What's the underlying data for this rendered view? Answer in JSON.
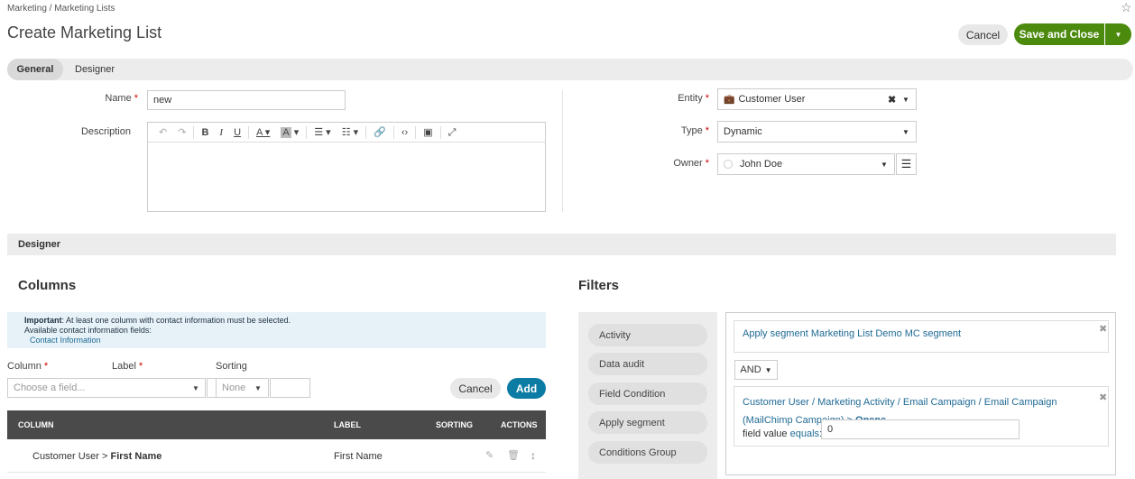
{
  "breadcrumb": "Marketing / Marketing Lists",
  "page_title": "Create Marketing List",
  "actions": {
    "cancel": "Cancel",
    "save_and_close": "Save and Close"
  },
  "tabs": [
    {
      "label": "General"
    },
    {
      "label": "Designer"
    }
  ],
  "general": {
    "name_label": "Name",
    "name_value": "new",
    "description_label": "Description",
    "entity_label": "Entity",
    "entity_value": "Customer User",
    "type_label": "Type",
    "type_value": "Dynamic",
    "owner_label": "Owner",
    "owner_value": "John Doe"
  },
  "designer_section": "Designer",
  "columns": {
    "heading": "Columns",
    "info_important": "Important",
    "info_text": ": At least one column with contact information must be selected.",
    "info_line2": "Available contact information fields:",
    "info_link": "Contact Information",
    "column_label": "Column",
    "label_label": "Label",
    "sorting_label": "Sorting",
    "column_placeholder": "Choose a field...",
    "sorting_value": "None",
    "cancel": "Cancel",
    "add": "Add",
    "headers": [
      "COLUMN",
      "LABEL",
      "SORTING",
      "ACTIONS"
    ],
    "rows": [
      {
        "column_prefix": "Customer User > ",
        "column_field": "First Name",
        "label": "First Name"
      }
    ]
  },
  "filters": {
    "heading": "Filters",
    "items": [
      "Activity",
      "Data audit",
      "Field Condition",
      "Apply segment",
      "Conditions Group"
    ],
    "condition1": "Apply segment Marketing List Demo MC segment",
    "operator": "AND",
    "condition2_path": "Customer User / Marketing Activity / Email Campaign / Email Campaign (MailChimp Campaign) > ",
    "condition2_field": "Opens",
    "condition2_text": "field value",
    "condition2_op": "equals:",
    "condition2_value": "0"
  },
  "colors": {
    "save": "#4c8a0e",
    "add": "#0d7ca4",
    "link": "#1f6a95",
    "required": "#cc0000"
  }
}
